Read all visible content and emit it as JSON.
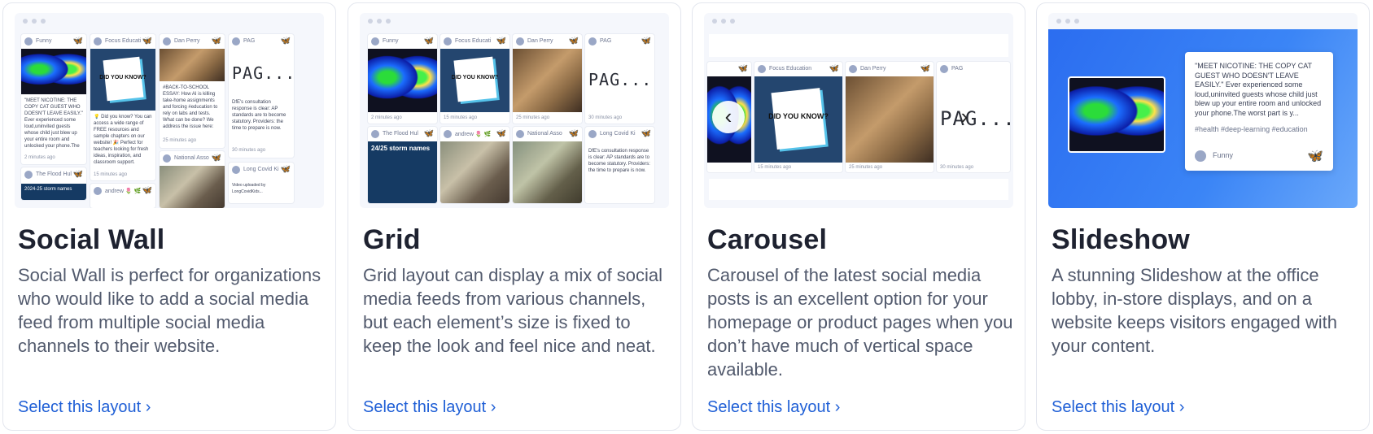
{
  "common": {
    "cta_label": "Select this layout ›",
    "time_label": "2 minutes ago",
    "time_15": "15 minutes ago",
    "time_25": "25 minutes ago",
    "time_30": "30 minutes ago"
  },
  "layouts": [
    {
      "title": "Social Wall",
      "description": "Social Wall is perfect for organizations who would like to add a social media feed from multiple social media channels to their website."
    },
    {
      "title": "Grid",
      "description": "Grid layout can display a mix of social media feeds from various channels, but each element’s size is fixed to keep the look and feel nice and neat."
    },
    {
      "title": "Carousel",
      "description": "Carousel of the latest social media posts is an excellent option for your homepage or product pages when you don’t have much of vertical space available."
    },
    {
      "title": "Slideshow",
      "description": "A stunning Slideshow at the office lobby, in-store displays, and on a website keeps visitors engaged with your content."
    }
  ],
  "posts": {
    "funny": "Funny",
    "focus": "Focus Educati",
    "focus_full": "Focus Education",
    "dan": "Dan Perry",
    "pag": "PAG",
    "pag_art": "PAG...",
    "flood": "The Flood Hul",
    "andrew": "andrew 🌷 🌿",
    "national": "National Asso",
    "longcovid": "Long Covid Ki",
    "nicotine_short": "\"MEET NICOTINE: THE COPY CAT GUEST WHO DOESN'T LEAVE EASILY.\" Ever experienced some loud,uninvited guests whose child just blew up your entire room and unlocked your phone.The worst part is y...",
    "dyk_short": "💡 Did you know? You can access a wide range of FREE resources and sample chapters on our website! 🎉 Perfect for teachers looking for fresh ideas, inspiration, and classroom support.",
    "dyk_art": "DID YOU KNOW?",
    "back_to_school": "#BACK-TO-SCHOOL ESSAY: How AI is killing take-home assignments and forcing #education to rely on labs and tests. What can be done? We address the issue here: ",
    "pag_text": "DfE's consultation response is clear: AP standards are to become statutory. Providers: the time to prepare is now.",
    "storm": "2024-25 storm names",
    "storm_grid": "24/25 storm names",
    "longcovid_text": "Video uploaded by LongCovidKids...",
    "slide_tags": "#health #deep-learning #education",
    "slide_author": "Funny"
  }
}
